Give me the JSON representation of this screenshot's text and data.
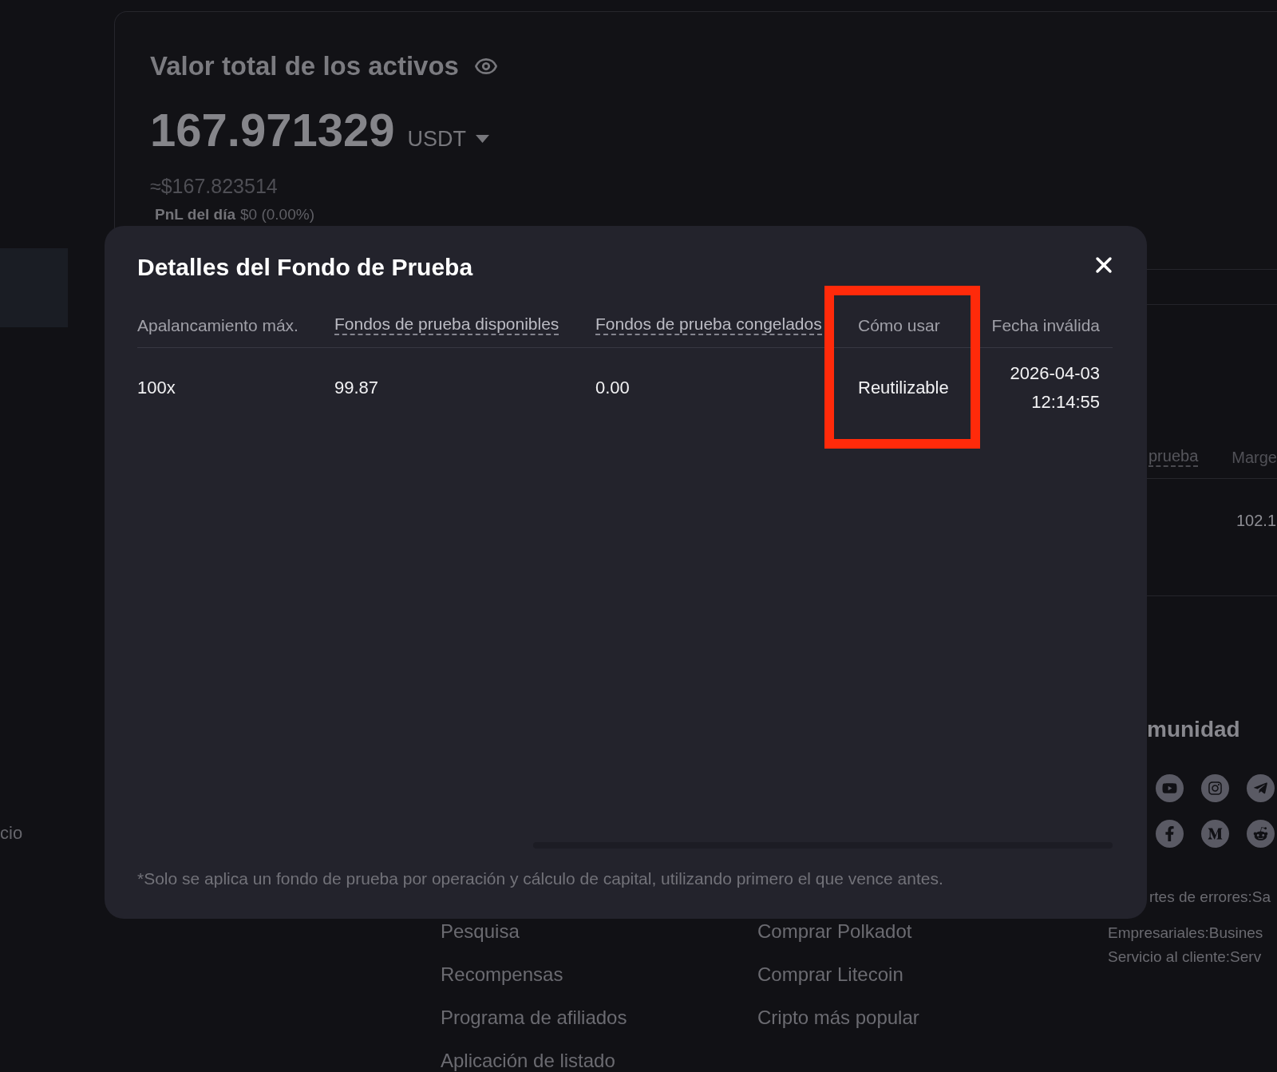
{
  "sidebar": {
    "items": [
      {
        "selected": true
      },
      {
        "label": "cio",
        "selected": false
      }
    ]
  },
  "assets_card": {
    "title": "Valor total de los activos",
    "value": "167.971329",
    "currency": "USDT",
    "approx_value": "≈$167.823514",
    "pnl_label": "PnL del día",
    "pnl_value": "$0 (0.00%)"
  },
  "positions_table": {
    "columns": [
      {
        "label": "prueba",
        "underlined": true
      },
      {
        "label": "Marge",
        "underlined": false,
        "values": [
          "102.1"
        ]
      }
    ]
  },
  "community": {
    "title": "munidad",
    "contacts": [
      "rtes de errores:Sa",
      "Empresariales:Busines",
      "Servicio al cliente:Serv"
    ]
  },
  "footer": {
    "columns": [
      {
        "links": [
          "Pesquisa",
          "Recompensas",
          "Programa de afiliados",
          "Aplicación de listado"
        ]
      },
      {
        "links": [
          "Comprar Polkadot",
          "Comprar Litecoin",
          "Cripto más popular"
        ]
      }
    ]
  },
  "modal": {
    "title": "Detalles del Fondo de Prueba",
    "table": {
      "columns": [
        {
          "label": "Apalancamiento máx.",
          "underlined": false,
          "highlighted": false
        },
        {
          "label": "Fondos de prueba disponibles",
          "underlined": true,
          "highlighted": false
        },
        {
          "label": "Fondos de prueba congelados",
          "underlined": true,
          "highlighted": false
        },
        {
          "label": "Cómo usar",
          "underlined": false,
          "highlighted": true
        },
        {
          "label": "Fecha inválida",
          "underlined": false,
          "highlighted": false
        }
      ],
      "rows": [
        [
          "100x",
          "99.87",
          "0.00",
          "Reutilizable",
          "2026-04-03 12:14:55"
        ]
      ]
    },
    "footnote": "*Solo se aplica un fondo de prueba por operación y cálculo de capital, utilizando primero el que vence antes."
  }
}
